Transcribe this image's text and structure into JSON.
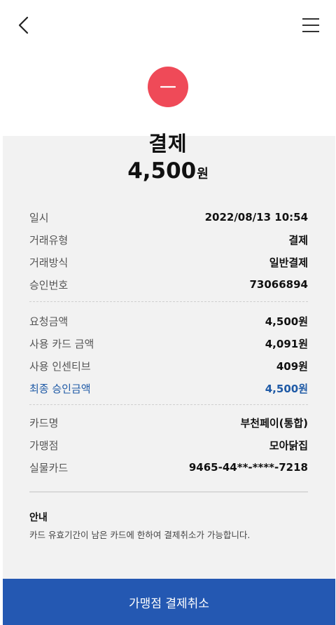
{
  "header": {
    "back_icon": "chevron-left-icon",
    "menu_icon": "hamburger-menu-icon"
  },
  "status": {
    "icon": "minus-icon",
    "color": "#ef4a58"
  },
  "summary": {
    "title": "결제",
    "amount": "4,500",
    "unit": "원"
  },
  "transaction": [
    {
      "label": "일시",
      "value": "2022/08/13 10:54"
    },
    {
      "label": "거래유형",
      "value": "결제"
    },
    {
      "label": "거래방식",
      "value": "일반결제"
    },
    {
      "label": "승인번호",
      "value": "73066894"
    }
  ],
  "amounts": [
    {
      "label": "요청금액",
      "value": "4,500원"
    },
    {
      "label": "사용 카드 금액",
      "value": "4,091원"
    },
    {
      "label": "사용 인센티브",
      "value": "409원"
    },
    {
      "label": "최종 승인금액",
      "value": "4,500원"
    }
  ],
  "card_info": [
    {
      "label": "카드명",
      "value": "부천페이(통합)"
    },
    {
      "label": "가맹점",
      "value": "모아닭집"
    },
    {
      "label": "실물카드",
      "value": "9465-44**-****-7218"
    }
  ],
  "notice": {
    "title": "안내",
    "text": "카드 유효기간이 남은 카드에 한하여 결제취소가 가능합니다."
  },
  "action": {
    "cancel_label": "가맹점 결제취소",
    "color": "#2458b2"
  },
  "colors": {
    "accent": "#1f5aa6"
  }
}
